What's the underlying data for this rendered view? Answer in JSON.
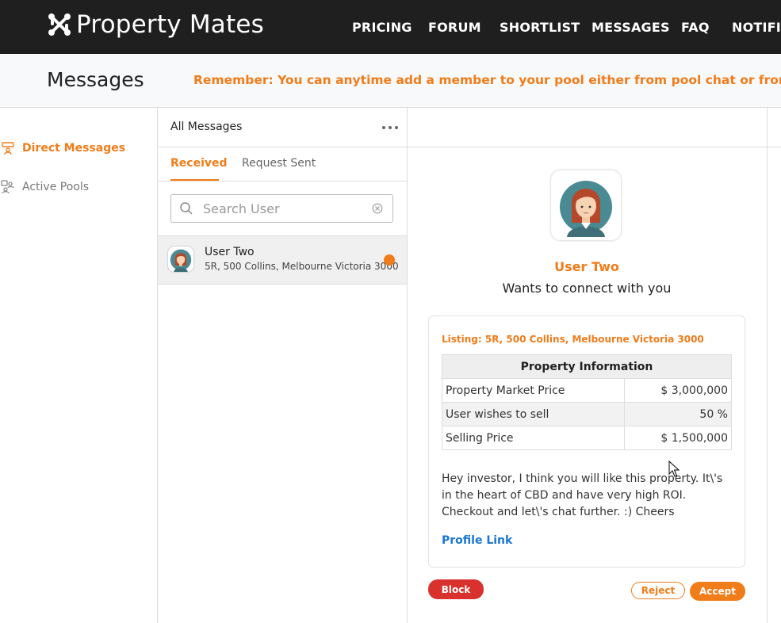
{
  "header": {
    "brand": "Property Mates",
    "nav": [
      "PRICING",
      "FORUM",
      "SHORTLIST",
      "MESSAGES",
      "FAQ",
      "NOTIFIC"
    ]
  },
  "subheader": {
    "title": "Messages",
    "reminder": "Remember: You can anytime add a member to your pool either from pool chat or from your listi"
  },
  "sidebar": {
    "items": [
      {
        "label": "Direct Messages",
        "icon": "direct-messages-icon",
        "active": true
      },
      {
        "label": "Active Pools",
        "icon": "pools-icon",
        "active": false
      }
    ]
  },
  "list": {
    "title": "All Messages",
    "tabs": [
      "Received",
      "Request Sent"
    ],
    "search_placeholder": "Search User",
    "items": [
      {
        "name": "User Two",
        "address": "5R, 500 Collins, Melbourne Victoria 3000",
        "unread": true
      }
    ]
  },
  "detail": {
    "name": "User Two",
    "subtitle": "Wants to connect with you",
    "listing": "Listing: 5R, 500 Collins, Melbourne Victoria 3000",
    "table": {
      "header": "Property Information",
      "rows": [
        {
          "label": "Property Market Price",
          "value": "$ 3,000,000"
        },
        {
          "label": "User wishes to sell",
          "value": "50 %"
        },
        {
          "label": "Selling Price",
          "value": "$ 1,500,000"
        }
      ]
    },
    "message": "Hey investor, I think you will like this property. It\\'s in the heart of CBD and have very high ROI. Checkout and let\\'s chat further. :) Cheers",
    "profile_link": "Profile Link",
    "buttons": {
      "block": "Block",
      "reject": "Reject",
      "accept": "Accept"
    }
  },
  "colors": {
    "accent": "#f07c1a",
    "topbar": "#1f1f1f",
    "danger": "#d9322e",
    "link": "#1976d2"
  }
}
